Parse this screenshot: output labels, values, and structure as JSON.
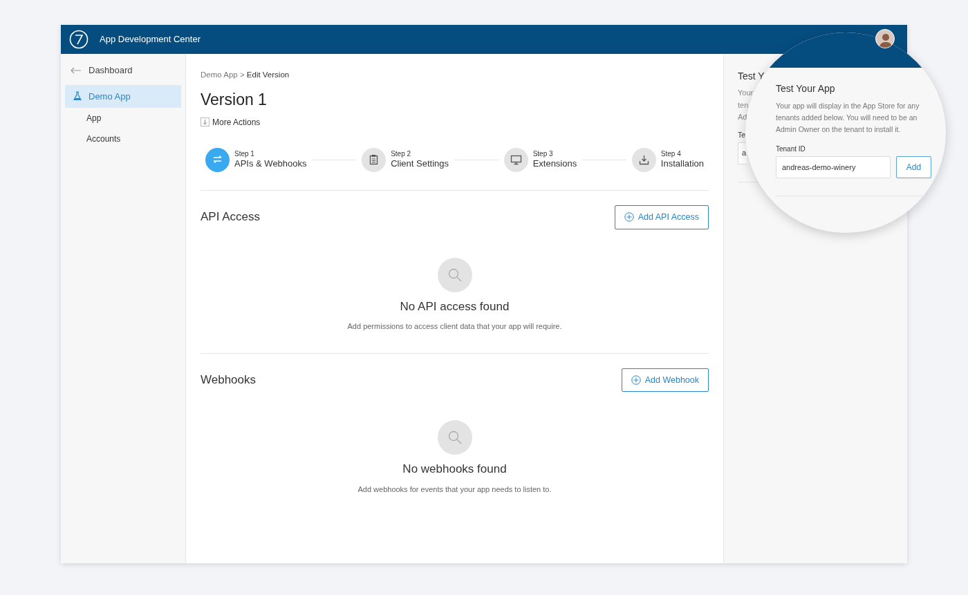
{
  "header": {
    "title": "App Development Center"
  },
  "sidebar": {
    "back": "Dashboard",
    "items": [
      {
        "label": "Demo App",
        "selected": true,
        "children": [
          {
            "label": "App",
            "selected": false
          },
          {
            "label": "Accounts",
            "selected": false
          }
        ]
      }
    ]
  },
  "breadcrumb": {
    "items": [
      "Demo App",
      "Edit Version"
    ],
    "separator": ">"
  },
  "title": "Version 1",
  "more_actions": "More Actions",
  "steps": [
    {
      "step": "Step 1",
      "label": "APIs & Webhooks",
      "selected": true
    },
    {
      "step": "Step 2",
      "label": "Client Settings",
      "selected": false
    },
    {
      "step": "Step 3",
      "label": "Extensions",
      "selected": false
    },
    {
      "step": "Step 4",
      "label": "Installation",
      "selected": false
    }
  ],
  "sections": [
    {
      "title": "API Access",
      "button": "Add API Access",
      "empty_title": "No API access found",
      "empty_text": "Add permissions to access client data that your app will require."
    },
    {
      "title": "Webhooks",
      "button": "Add Webhook",
      "empty_title": "No webhooks found",
      "empty_text": "Add webhooks for events that your app needs to listen to."
    }
  ],
  "side_panel": {
    "title": "Test Y",
    "lines": [
      "Your",
      "ten",
      "Ad"
    ],
    "field_label": "Te",
    "field_value": "a"
  },
  "magnifier": {
    "title": "Test Your App",
    "description": "Your app will display in the App Store for any tenants added below. You will need to be an Admin Owner on the tenant to install it.",
    "field_label": "Tenant ID",
    "field_value": "andreas-demo-winery",
    "button": "Add"
  }
}
